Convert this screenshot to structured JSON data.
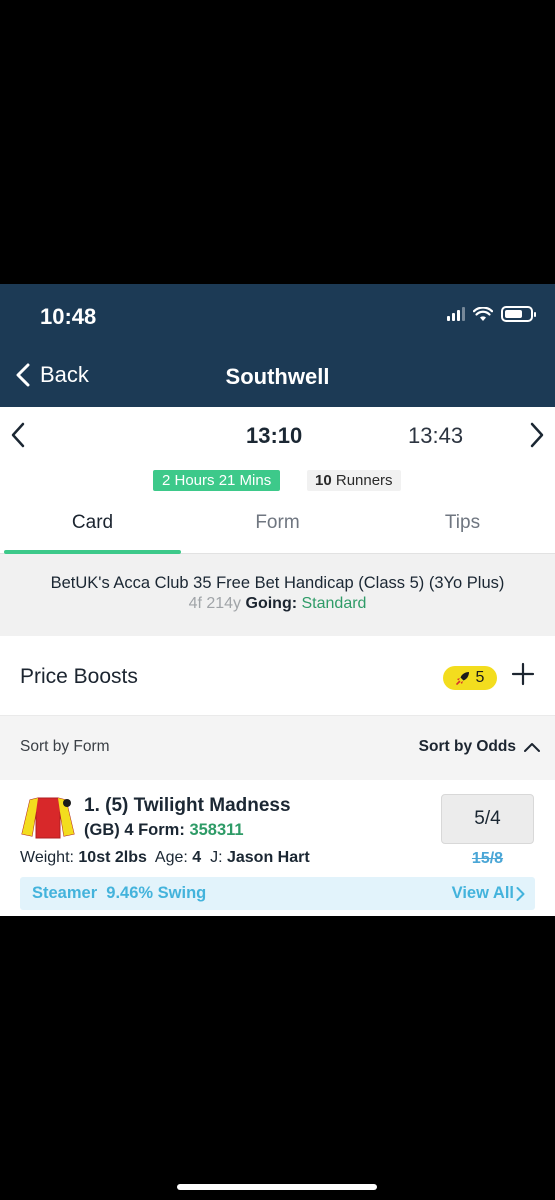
{
  "status_bar": {
    "time": "10:48"
  },
  "nav": {
    "back_label": "Back",
    "title": "Southwell"
  },
  "race_nav": {
    "current_time": "13:10",
    "next_time": "13:43"
  },
  "race_status": {
    "countdown": "2 Hours 21 Mins",
    "runners_count": "10",
    "runners_label": "Runners"
  },
  "tabs": [
    {
      "label": "Card",
      "active": true
    },
    {
      "label": "Form",
      "active": false
    },
    {
      "label": "Tips",
      "active": false
    }
  ],
  "race_info": {
    "name": "BetUK's Acca Club 35 Free Bet Handicap (Class 5) (3Yo Plus)",
    "distance": "4f 214y",
    "going_label": "Going:",
    "going_value": "Standard"
  },
  "price_boosts": {
    "label": "Price Boosts",
    "count": "5"
  },
  "sort": {
    "by_form_label": "Sort by Form",
    "by_odds_label": "Sort by Odds"
  },
  "runners": [
    {
      "title": "1. (5) Twilight Madness",
      "origin_age": "(GB) 4",
      "form_label": "Form:",
      "form": "358311",
      "weight_label": "Weight:",
      "weight": "10st 2lbs",
      "age_label": "Age:",
      "age": "4",
      "jockey_label": "J:",
      "jockey": "Jason Hart",
      "odds": "5/4",
      "previous_odds": "15/8",
      "swing_text": "Steamer  9.46% Swing",
      "swing_link": "View All"
    }
  ],
  "colors": {
    "header_bg": "#1c3a55",
    "accent_green": "#3dc98a",
    "boost_yellow": "#f3dd1e",
    "swing_blue": "#43b3dc"
  }
}
